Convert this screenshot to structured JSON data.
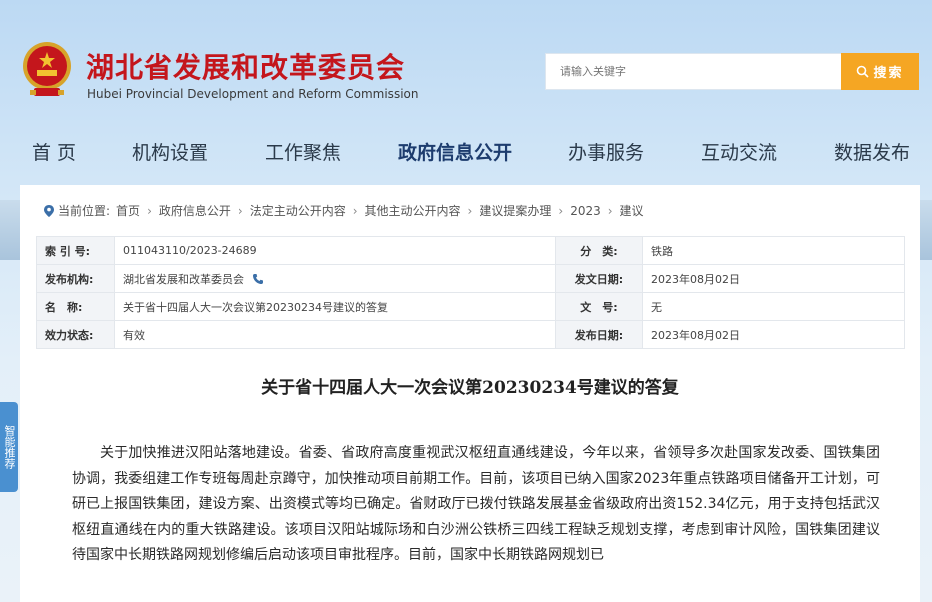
{
  "header": {
    "title": "湖北省发展和改革委员会",
    "subtitle": "Hubei Provincial Development and Reform Commission",
    "search_placeholder": "请输入关键字",
    "search_label": "搜索"
  },
  "nav": {
    "items": [
      "首 页",
      "机构设置",
      "工作聚焦",
      "政府信息公开",
      "办事服务",
      "互动交流",
      "数据发布"
    ],
    "active_index": 3
  },
  "breadcrumb": {
    "prefix": "当前位置:",
    "items": [
      "首页",
      "政府信息公开",
      "法定主动公开内容",
      "其他主动公开内容",
      "建议提案办理",
      "2023",
      "建议"
    ]
  },
  "meta": {
    "rows": [
      {
        "l1": "索 引 号:",
        "v1": "011043110/2023-24689",
        "l2": "分　类:",
        "v2": "铁路"
      },
      {
        "l1": "发布机构:",
        "v1": "湖北省发展和改革委员会",
        "l2": "发文日期:",
        "v2": "2023年08月02日"
      },
      {
        "l1": "名　称:",
        "v1": "关于省十四届人大一次会议第20230234号建议的答复",
        "l2": "文　号:",
        "v2": "无"
      },
      {
        "l1": "效力状态:",
        "v1": "有效",
        "l2": "发布日期:",
        "v2": "2023年08月02日"
      }
    ]
  },
  "document": {
    "title": "关于省十四届人大一次会议第20230234号建议的答复",
    "paragraph": "关于加快推进汉阳站落地建设。省委、省政府高度重视武汉枢纽直通线建设，今年以来，省领导多次赴国家发改委、国铁集团协调，我委组建工作专班每周赴京蹲守，加快推动项目前期工作。目前，该项目已纳入国家2023年重点铁路项目储备开工计划，可研已上报国铁集团，建设方案、出资模式等均已确定。省财政厅已拨付铁路发展基金省级政府出资152.34亿元，用于支持包括武汉枢纽直通线在内的重大铁路建设。该项目汉阳站城际场和白沙洲公铁桥三四线工程缺乏规划支撑，考虑到审计风险，国铁集团建议待国家中长期铁路网规划修编后启动该项目审批程序。目前，国家中长期铁路网规划已"
  },
  "side_tab": {
    "label": "智能推荐"
  },
  "colors": {
    "brand_red": "#c4161c",
    "search_orange": "#f5a623",
    "nav_text": "#2b3a4a"
  }
}
